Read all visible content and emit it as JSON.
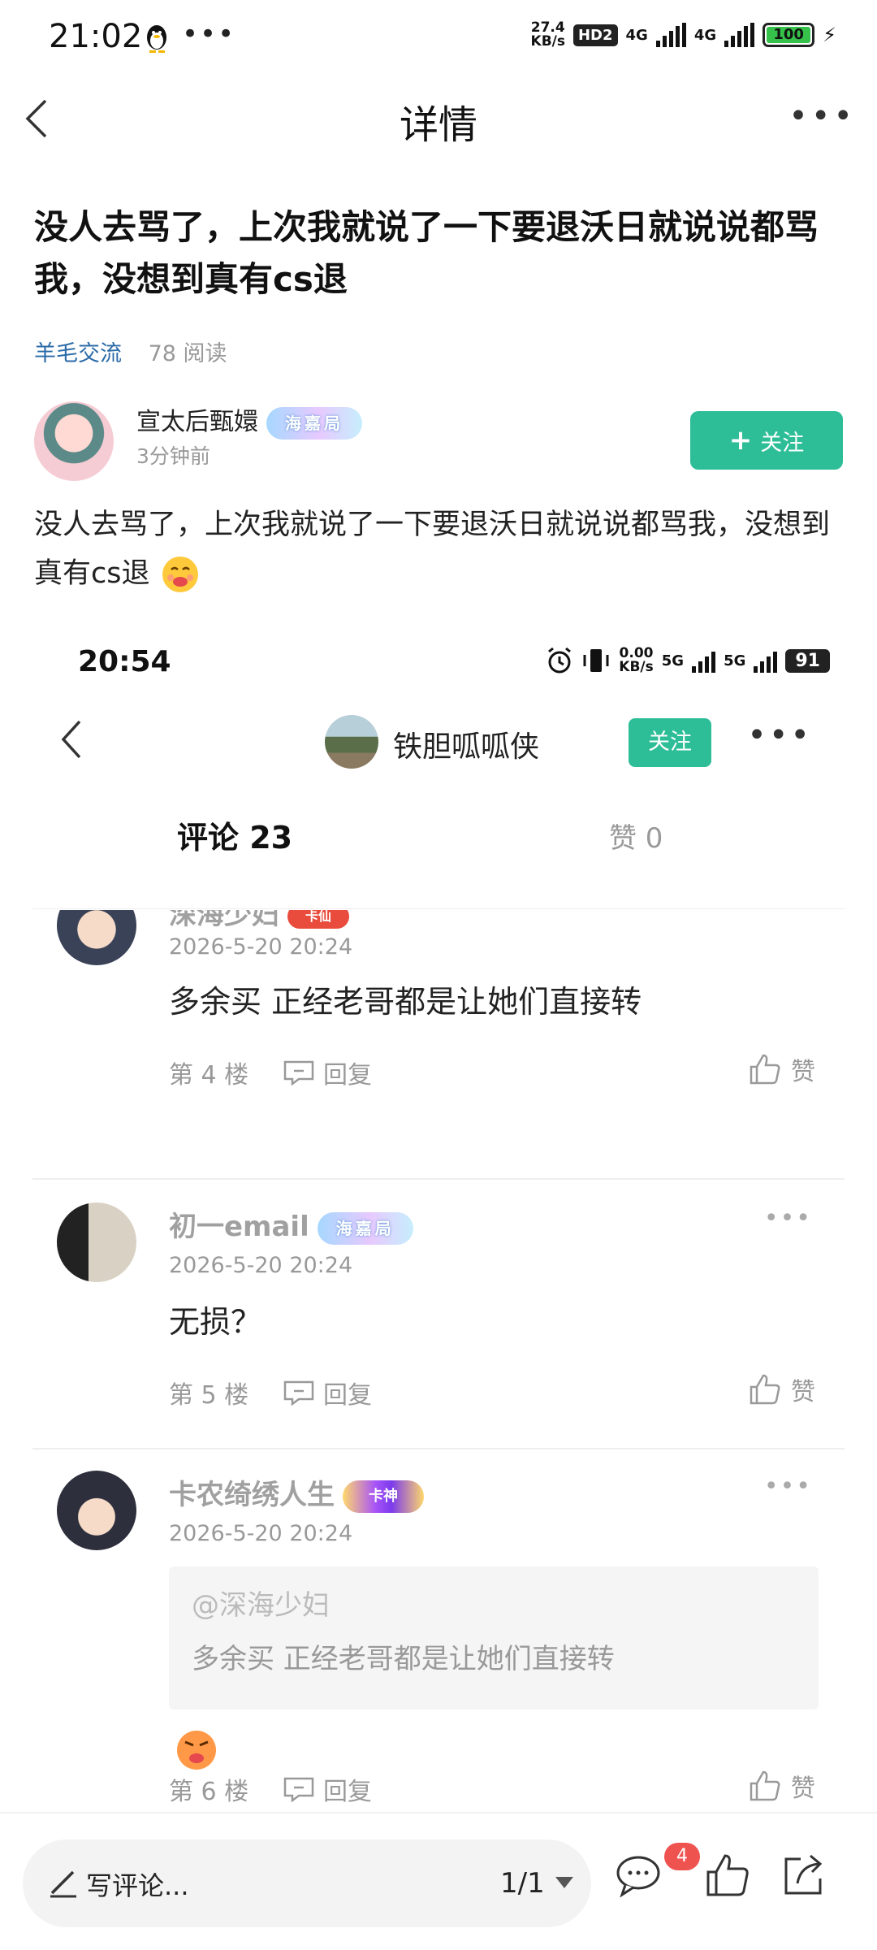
{
  "status_bar": {
    "time": "21:02",
    "dots": "•••",
    "net_speed_value": "27.4",
    "net_speed_unit": "KB/s",
    "hd_badge": "HD2",
    "net1": "4G",
    "net2": "4G",
    "battery": "100"
  },
  "nav": {
    "title": "详情",
    "more": "•••"
  },
  "post": {
    "title": "没人去骂了，上次我就说了一下要退沃日就说说都骂我，没想到真有cs退",
    "tag": "羊毛交流",
    "views": "78 阅读",
    "author": {
      "name": "宣太后甄嬛",
      "badge": "海嘉局",
      "time": "3分钟前"
    },
    "follow_label": "关注",
    "body": "没人去骂了，上次我就说了一下要退沃日就说说都骂我，没想到真有cs退"
  },
  "screenshot": {
    "time": "20:54",
    "speed_value": "0.00",
    "speed_unit": "KB/s",
    "net1": "5G",
    "net2": "5G",
    "battery": "91",
    "page_name": "铁胆呱呱侠",
    "follow_label": "关注",
    "more": "•••",
    "tab_comments": "评论 23",
    "tab_likes": "赞 0",
    "comments": [
      {
        "name": "深海少妇",
        "badge": "卡仙",
        "time": "2026-5-20 20:24",
        "text": "多余买   正经老哥都是让她们直接转",
        "floor": "第 4 楼",
        "reply": "回复",
        "like": "赞"
      },
      {
        "name": "初一email",
        "badge": "海嘉局",
        "time": "2026-5-20 20:24",
        "text": "无损？",
        "floor": "第 5 楼",
        "reply": "回复",
        "like": "赞",
        "more": "•••"
      },
      {
        "name": "卡农绮绣人生",
        "badge": "卡神",
        "time": "2026-5-20 20:24",
        "quote_user": "@深海少妇",
        "quote_text": "多余买   正经老哥都是让她们直接转",
        "floor": "第 6 楼",
        "reply": "回复",
        "like": "赞",
        "more": "•••"
      }
    ]
  },
  "bottom_bar": {
    "input_label": "写评论...",
    "page_indicator": "1/1",
    "notification_count": "4"
  },
  "colors": {
    "accent": "#2dbd97",
    "tag_blue": "#2a6aa8",
    "badge_red": "#ef5350"
  }
}
